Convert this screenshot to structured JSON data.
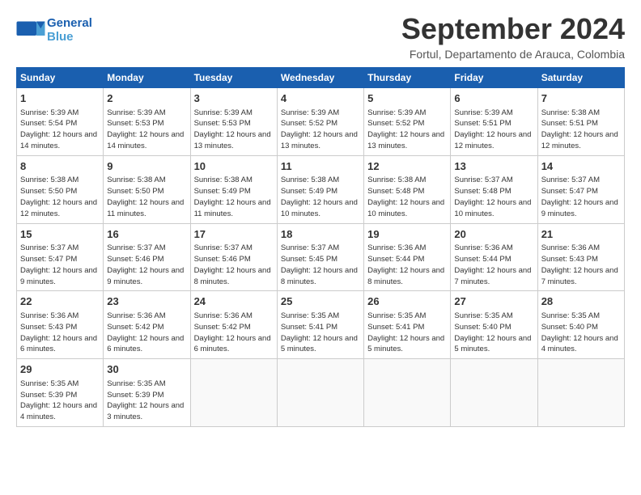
{
  "header": {
    "logo_line1": "General",
    "logo_line2": "Blue",
    "month_title": "September 2024",
    "location": "Fortul, Departamento de Arauca, Colombia"
  },
  "weekdays": [
    "Sunday",
    "Monday",
    "Tuesday",
    "Wednesday",
    "Thursday",
    "Friday",
    "Saturday"
  ],
  "days": [
    {
      "num": "",
      "info": ""
    },
    {
      "num": "",
      "info": ""
    },
    {
      "num": "",
      "info": ""
    },
    {
      "num": "",
      "info": ""
    },
    {
      "num": "",
      "info": ""
    },
    {
      "num": "",
      "info": ""
    },
    {
      "num": "",
      "info": ""
    },
    {
      "num": "1",
      "sunrise": "Sunrise: 5:39 AM",
      "sunset": "Sunset: 5:54 PM",
      "daylight": "Daylight: 12 hours and 14 minutes."
    },
    {
      "num": "2",
      "sunrise": "Sunrise: 5:39 AM",
      "sunset": "Sunset: 5:53 PM",
      "daylight": "Daylight: 12 hours and 14 minutes."
    },
    {
      "num": "3",
      "sunrise": "Sunrise: 5:39 AM",
      "sunset": "Sunset: 5:53 PM",
      "daylight": "Daylight: 12 hours and 13 minutes."
    },
    {
      "num": "4",
      "sunrise": "Sunrise: 5:39 AM",
      "sunset": "Sunset: 5:52 PM",
      "daylight": "Daylight: 12 hours and 13 minutes."
    },
    {
      "num": "5",
      "sunrise": "Sunrise: 5:39 AM",
      "sunset": "Sunset: 5:52 PM",
      "daylight": "Daylight: 12 hours and 13 minutes."
    },
    {
      "num": "6",
      "sunrise": "Sunrise: 5:39 AM",
      "sunset": "Sunset: 5:51 PM",
      "daylight": "Daylight: 12 hours and 12 minutes."
    },
    {
      "num": "7",
      "sunrise": "Sunrise: 5:38 AM",
      "sunset": "Sunset: 5:51 PM",
      "daylight": "Daylight: 12 hours and 12 minutes."
    },
    {
      "num": "8",
      "sunrise": "Sunrise: 5:38 AM",
      "sunset": "Sunset: 5:50 PM",
      "daylight": "Daylight: 12 hours and 12 minutes."
    },
    {
      "num": "9",
      "sunrise": "Sunrise: 5:38 AM",
      "sunset": "Sunset: 5:50 PM",
      "daylight": "Daylight: 12 hours and 11 minutes."
    },
    {
      "num": "10",
      "sunrise": "Sunrise: 5:38 AM",
      "sunset": "Sunset: 5:49 PM",
      "daylight": "Daylight: 12 hours and 11 minutes."
    },
    {
      "num": "11",
      "sunrise": "Sunrise: 5:38 AM",
      "sunset": "Sunset: 5:49 PM",
      "daylight": "Daylight: 12 hours and 10 minutes."
    },
    {
      "num": "12",
      "sunrise": "Sunrise: 5:38 AM",
      "sunset": "Sunset: 5:48 PM",
      "daylight": "Daylight: 12 hours and 10 minutes."
    },
    {
      "num": "13",
      "sunrise": "Sunrise: 5:37 AM",
      "sunset": "Sunset: 5:48 PM",
      "daylight": "Daylight: 12 hours and 10 minutes."
    },
    {
      "num": "14",
      "sunrise": "Sunrise: 5:37 AM",
      "sunset": "Sunset: 5:47 PM",
      "daylight": "Daylight: 12 hours and 9 minutes."
    },
    {
      "num": "15",
      "sunrise": "Sunrise: 5:37 AM",
      "sunset": "Sunset: 5:47 PM",
      "daylight": "Daylight: 12 hours and 9 minutes."
    },
    {
      "num": "16",
      "sunrise": "Sunrise: 5:37 AM",
      "sunset": "Sunset: 5:46 PM",
      "daylight": "Daylight: 12 hours and 9 minutes."
    },
    {
      "num": "17",
      "sunrise": "Sunrise: 5:37 AM",
      "sunset": "Sunset: 5:46 PM",
      "daylight": "Daylight: 12 hours and 8 minutes."
    },
    {
      "num": "18",
      "sunrise": "Sunrise: 5:37 AM",
      "sunset": "Sunset: 5:45 PM",
      "daylight": "Daylight: 12 hours and 8 minutes."
    },
    {
      "num": "19",
      "sunrise": "Sunrise: 5:36 AM",
      "sunset": "Sunset: 5:44 PM",
      "daylight": "Daylight: 12 hours and 8 minutes."
    },
    {
      "num": "20",
      "sunrise": "Sunrise: 5:36 AM",
      "sunset": "Sunset: 5:44 PM",
      "daylight": "Daylight: 12 hours and 7 minutes."
    },
    {
      "num": "21",
      "sunrise": "Sunrise: 5:36 AM",
      "sunset": "Sunset: 5:43 PM",
      "daylight": "Daylight: 12 hours and 7 minutes."
    },
    {
      "num": "22",
      "sunrise": "Sunrise: 5:36 AM",
      "sunset": "Sunset: 5:43 PM",
      "daylight": "Daylight: 12 hours and 6 minutes."
    },
    {
      "num": "23",
      "sunrise": "Sunrise: 5:36 AM",
      "sunset": "Sunset: 5:42 PM",
      "daylight": "Daylight: 12 hours and 6 minutes."
    },
    {
      "num": "24",
      "sunrise": "Sunrise: 5:36 AM",
      "sunset": "Sunset: 5:42 PM",
      "daylight": "Daylight: 12 hours and 6 minutes."
    },
    {
      "num": "25",
      "sunrise": "Sunrise: 5:35 AM",
      "sunset": "Sunset: 5:41 PM",
      "daylight": "Daylight: 12 hours and 5 minutes."
    },
    {
      "num": "26",
      "sunrise": "Sunrise: 5:35 AM",
      "sunset": "Sunset: 5:41 PM",
      "daylight": "Daylight: 12 hours and 5 minutes."
    },
    {
      "num": "27",
      "sunrise": "Sunrise: 5:35 AM",
      "sunset": "Sunset: 5:40 PM",
      "daylight": "Daylight: 12 hours and 5 minutes."
    },
    {
      "num": "28",
      "sunrise": "Sunrise: 5:35 AM",
      "sunset": "Sunset: 5:40 PM",
      "daylight": "Daylight: 12 hours and 4 minutes."
    },
    {
      "num": "29",
      "sunrise": "Sunrise: 5:35 AM",
      "sunset": "Sunset: 5:39 PM",
      "daylight": "Daylight: 12 hours and 4 minutes."
    },
    {
      "num": "30",
      "sunrise": "Sunrise: 5:35 AM",
      "sunset": "Sunset: 5:39 PM",
      "daylight": "Daylight: 12 hours and 3 minutes."
    }
  ]
}
